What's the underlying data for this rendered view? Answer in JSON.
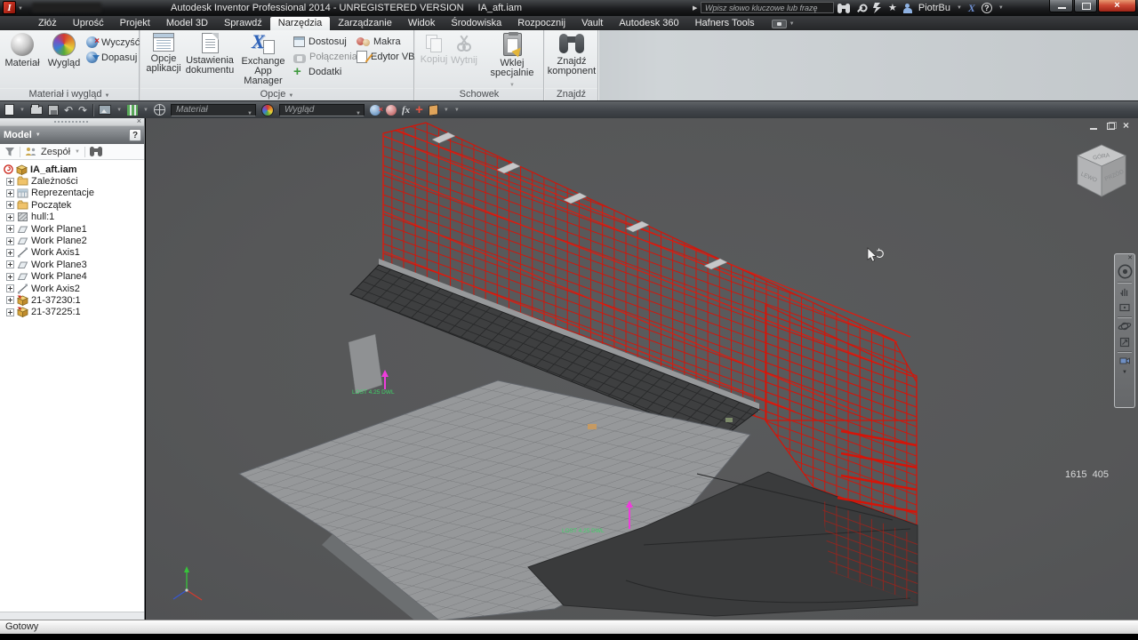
{
  "title_bar": {
    "title": "Autodesk Inventor Professional 2014 - UNREGISTERED VERSION",
    "document": "IA_aft.iam",
    "search_placeholder": "Wpisz słowo kluczowe lub frazę",
    "user": "PiotrBu",
    "exchange_logo": "X",
    "help": "?"
  },
  "tabs": {
    "items": [
      "Złóż",
      "Uprość",
      "Projekt",
      "Model 3D",
      "Sprawdź",
      "Narzędzia",
      "Zarządzanie",
      "Widok",
      "Środowiska",
      "Rozpocznij",
      "Vault",
      "Autodesk 360",
      "Hafners Tools"
    ],
    "active": "Narzędzia"
  },
  "ribbon": {
    "material_group": {
      "label": "Materiał i wygląd",
      "material": "Materiał",
      "appearance": "Wygląd",
      "clear": "Wyczyść",
      "adjust": "Dopasuj"
    },
    "options_group": {
      "label": "Opcje",
      "app_options": "Opcje aplikacji",
      "doc_settings": "Ustawienia dokumentu",
      "exchange": "Exchange App Manager",
      "customize": "Dostosuj",
      "links": "Połączenia",
      "addins": "Dodatki",
      "macros": "Makra",
      "vba": "Edytor VBA"
    },
    "clipboard_group": {
      "label": "Schowek",
      "copy": "Kopiuj",
      "cut": "Wytnij",
      "paste": "Wklej specjalnie"
    },
    "find_group": {
      "label": "Znajdź",
      "find_component": "Znajdź komponent"
    }
  },
  "quick_toolbar": {
    "material_combo": "Materiał",
    "appearance_combo": "Wygląd",
    "fx_label": "fx"
  },
  "browser": {
    "header": "Model",
    "help": "?",
    "assembly_filter": "Zespół",
    "tree": [
      {
        "label": "IA_aft.iam",
        "icon": "assembly-root"
      },
      {
        "label": "Zależności",
        "icon": "folder"
      },
      {
        "label": "Reprezentacje",
        "icon": "representations"
      },
      {
        "label": "Początek",
        "icon": "folder"
      },
      {
        "label": "hull:1",
        "icon": "hull-part"
      },
      {
        "label": "Work Plane1",
        "icon": "work-plane"
      },
      {
        "label": "Work Plane2",
        "icon": "work-plane"
      },
      {
        "label": "Work Axis1",
        "icon": "work-axis"
      },
      {
        "label": "Work Plane3",
        "icon": "work-plane"
      },
      {
        "label": "Work Plane4",
        "icon": "work-plane"
      },
      {
        "label": "Work Axis2",
        "icon": "work-axis"
      },
      {
        "label": "21-37230:1",
        "icon": "part"
      },
      {
        "label": "21-37225:1",
        "icon": "part"
      }
    ]
  },
  "viewport": {
    "coordinates": "1615  405",
    "annotations": [
      {
        "text": "LOST 4.25 DWL"
      },
      {
        "text": "LOST 4.25 DWL"
      }
    ],
    "viewcube": {
      "top": "GÓRA",
      "left": "LEWO",
      "right": "PRZÓD"
    }
  },
  "status_bar": {
    "message": "Gotowy"
  }
}
